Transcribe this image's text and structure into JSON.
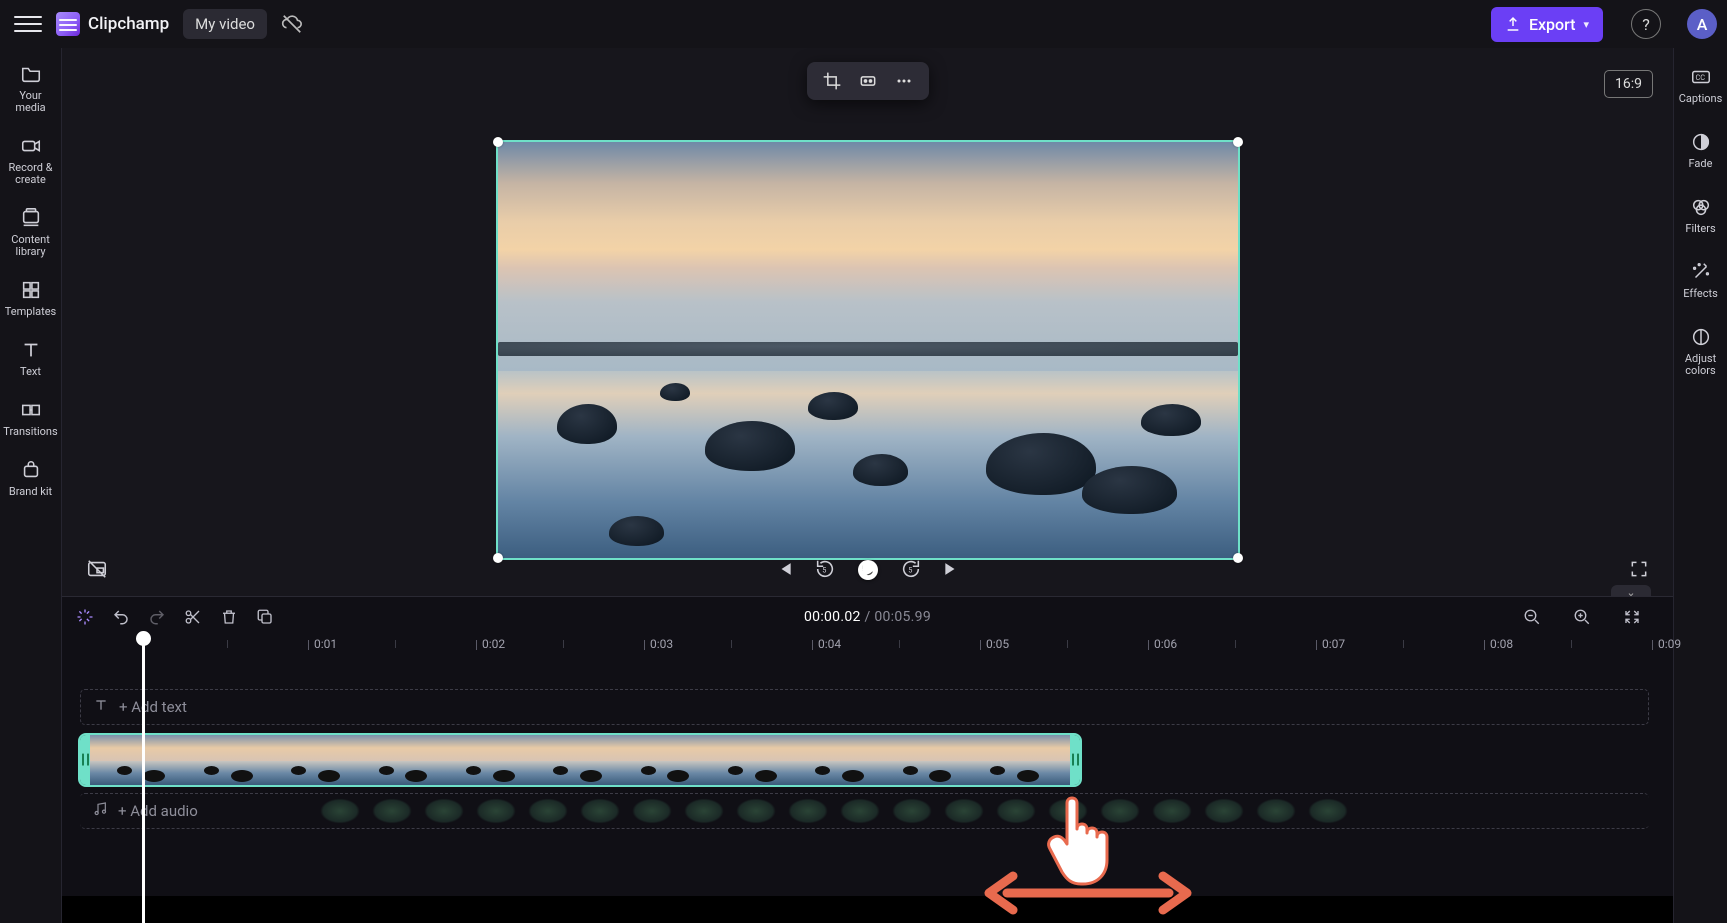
{
  "header": {
    "app_name": "Clipchamp",
    "project_title": "My video",
    "export_label": "Export",
    "help_glyph": "?",
    "avatar_initial": "A"
  },
  "left_rail": {
    "items": [
      {
        "key": "your-media",
        "label": "Your media"
      },
      {
        "key": "record",
        "label": "Record & create"
      },
      {
        "key": "library",
        "label": "Content library"
      },
      {
        "key": "templates",
        "label": "Templates"
      },
      {
        "key": "text",
        "label": "Text"
      },
      {
        "key": "transitions",
        "label": "Transitions"
      },
      {
        "key": "brand",
        "label": "Brand kit"
      }
    ]
  },
  "right_rail": {
    "items": [
      {
        "key": "captions",
        "label": "Captions"
      },
      {
        "key": "fade",
        "label": "Fade"
      },
      {
        "key": "filters",
        "label": "Filters"
      },
      {
        "key": "effects",
        "label": "Effects"
      },
      {
        "key": "adjust",
        "label": "Adjust colors"
      }
    ]
  },
  "preview": {
    "aspect_label": "16:9"
  },
  "timeline": {
    "current_time": "00:00.02",
    "separator": " / ",
    "total_time": "00:05.99",
    "ticks": [
      "0:01",
      "0:02",
      "0:03",
      "0:04",
      "0:05",
      "0:06",
      "0:07",
      "0:08",
      "0:09"
    ],
    "add_text_label": "+ Add text",
    "add_audio_label": "+ Add audio"
  },
  "colors": {
    "accent": "#6b3ff5",
    "selection": "#6fe0c8",
    "tutorial_coral": "#e86a4e"
  }
}
